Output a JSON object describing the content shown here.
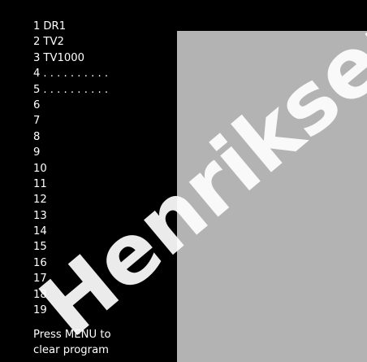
{
  "channels": [
    {
      "number": "1",
      "name": "DR1"
    },
    {
      "number": "2",
      "name": "TV2"
    },
    {
      "number": "3",
      "name": "TV1000"
    },
    {
      "number": "4",
      "name": ". . . . . . . . . ."
    },
    {
      "number": "5",
      "name": ". . . . . . . . . ."
    },
    {
      "number": "6",
      "name": ""
    },
    {
      "number": "7",
      "name": ""
    },
    {
      "number": "8",
      "name": ""
    },
    {
      "number": "9",
      "name": ""
    },
    {
      "number": "10",
      "name": ""
    },
    {
      "number": "11",
      "name": ""
    },
    {
      "number": "12",
      "name": ""
    },
    {
      "number": "13",
      "name": ""
    },
    {
      "number": "14",
      "name": ""
    },
    {
      "number": "15",
      "name": ""
    },
    {
      "number": "16",
      "name": ""
    },
    {
      "number": "17",
      "name": ""
    },
    {
      "number": "18",
      "name": ""
    },
    {
      "number": "19",
      "name": ""
    }
  ],
  "hint": {
    "line1": "Press MENU to",
    "line2": "clear program"
  },
  "watermark": {
    "text": "Henriksen"
  },
  "colors": {
    "background": "#000000",
    "text": "#ffffff",
    "preview": "#b3b3b3",
    "watermark": "#ffffff"
  }
}
